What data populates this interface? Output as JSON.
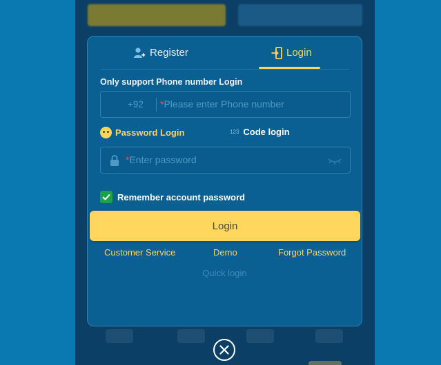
{
  "tabs": {
    "register": "Register",
    "login": "Login"
  },
  "hint": "Only support Phone number Login",
  "phone": {
    "prefix": "+92",
    "required_mark": "*",
    "placeholder": "Please enter Phone number"
  },
  "modes": {
    "password": "Password Login",
    "code_icon": "123",
    "code": "Code login"
  },
  "password": {
    "required_mark": "*",
    "placeholder": "Enter password"
  },
  "remember": {
    "label": "Remember account password",
    "checked": true
  },
  "login_button": "Login",
  "links": {
    "customer_service": "Customer Service",
    "demo": "Demo",
    "forgot": "Forgot Password"
  },
  "quick_login": "Quick login",
  "icons": {
    "register": "user-plus-icon",
    "login": "login-door-icon",
    "password_mode": "smiley-icon",
    "code_mode": "numeric-123-icon",
    "lock": "lock-icon",
    "eye": "eye-closed-icon",
    "close": "close-icon"
  },
  "colors": {
    "accent": "#ffd45a",
    "check": "#1da04c",
    "modal_bg": "#0a5f93",
    "page_bg": "#0a79b1"
  }
}
